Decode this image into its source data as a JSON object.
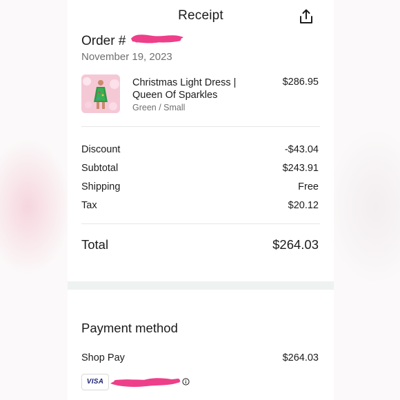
{
  "header": {
    "title": "Receipt",
    "share_icon": "share-icon"
  },
  "order": {
    "label": "Order #",
    "date": "November 19, 2023"
  },
  "item": {
    "name_line1": "Christmas Light Dress |",
    "name_line2": "Queen Of Sparkles",
    "variant": "Green / Small",
    "price": "$286.95"
  },
  "summary": [
    {
      "label": "Discount",
      "value": "-$43.04"
    },
    {
      "label": "Subtotal",
      "value": "$243.91"
    },
    {
      "label": "Shipping",
      "value": "Free"
    },
    {
      "label": "Tax",
      "value": "$20.12"
    }
  ],
  "total": {
    "label": "Total",
    "value": "$264.03"
  },
  "payment": {
    "title": "Payment method",
    "method": "Shop Pay",
    "amount": "$264.03",
    "card_brand": "VISA",
    "info_icon": "info-icon"
  },
  "colors": {
    "redaction": "#ee3f8a",
    "divider": "#e6e6e6",
    "band": "#eef2f1"
  }
}
